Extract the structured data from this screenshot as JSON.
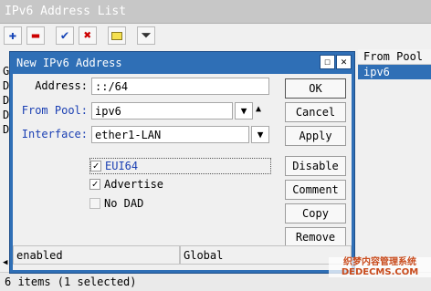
{
  "parent": {
    "title": "IPv6 Address List",
    "column_header": "From Pool",
    "selected_row_value": "ipv6",
    "row_stubs": [
      "G",
      "D",
      "D",
      "D",
      "D"
    ],
    "status_text": "6 items (1 selected)",
    "toolbar_icons": [
      "plus-icon",
      "minus-icon",
      "check-icon",
      "x-icon",
      "note-icon",
      "filter-icon"
    ]
  },
  "dialog": {
    "title": "New IPv6 Address",
    "address_label": "Address:",
    "address_value": "::/64",
    "from_pool_label": "From Pool:",
    "from_pool_value": "ipv6",
    "interface_label": "Interface:",
    "interface_value": "ether1-LAN",
    "eui64_label": "EUI64",
    "eui64_checked": true,
    "advertise_label": "Advertise",
    "advertise_checked": true,
    "nodad_label": "No DAD",
    "nodad_checked": false,
    "buttons": {
      "ok": "OK",
      "cancel": "Cancel",
      "apply": "Apply",
      "disable": "Disable",
      "comment": "Comment",
      "copy": "Copy",
      "remove": "Remove"
    },
    "status_enabled": "enabled",
    "status_scope": "Global"
  },
  "watermark": {
    "line1": "织梦内容管理系统",
    "line2": "DEDECMS.COM"
  },
  "colors": {
    "dialog_frame": "#2f6fb6",
    "label_blue": "#1a3fb3",
    "selection": "#2f6fb6"
  }
}
